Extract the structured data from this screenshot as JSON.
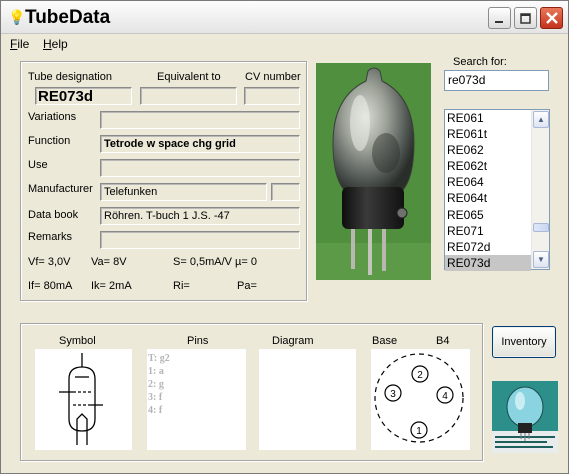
{
  "window": {
    "title": "TubeData",
    "icon": "bulb-icon"
  },
  "menu": [
    {
      "underline": "F",
      "rest": "ile"
    },
    {
      "underline": "H",
      "rest": "elp"
    }
  ],
  "fields": {
    "tube_designation_label": "Tube designation",
    "equivalent_label": "Equivalent to",
    "cv_label": "CV number",
    "tube_designation": "RE073d",
    "equivalent": "",
    "cv": "",
    "variations_label": "Variations",
    "variations": "",
    "function_label": "Function",
    "function": "Tetrode w space chg grid",
    "use_label": "Use",
    "use": "",
    "manufacturer_label": "Manufacturer",
    "manufacturer": "Telefunken",
    "manufacturer_extra": "",
    "databook_label": "Data book",
    "databook": "Röhren. T-buch 1 J.S. -47",
    "remarks_label": "Remarks",
    "remarks": ""
  },
  "params": {
    "vf": "Vf= 3,0V",
    "va": "Va= 8V",
    "s": "S= 0,5mA/V",
    "mu": "µ= 0",
    "if": "If= 80mA",
    "ik": "Ik= 2mA",
    "ri": "Ri=",
    "pa": "Pa="
  },
  "search": {
    "label": "Search for:",
    "value": "re073d"
  },
  "tube_list": [
    "RE061",
    "RE061t",
    "RE062",
    "RE062t",
    "RE064",
    "RE064t",
    "RE065",
    "RE071",
    "RE072d",
    "RE073d"
  ],
  "selected_tube": "RE073d",
  "bottom": {
    "symbol_label": "Symbol",
    "pins_label": "Pins",
    "diagram_label": "Diagram",
    "base_label": "Base",
    "base_type": "B4",
    "pins": [
      "T: g2",
      "1: a",
      "2: g",
      "3: f",
      "4: f"
    ],
    "base_pins": [
      "1",
      "2",
      "3",
      "4"
    ]
  },
  "inventory_button": "Inventory",
  "colors": {
    "accent": "#316ac5",
    "close": "#c4331d",
    "photo_bg": "#4f8f3e",
    "logo_bg": "#2d8f8a"
  }
}
